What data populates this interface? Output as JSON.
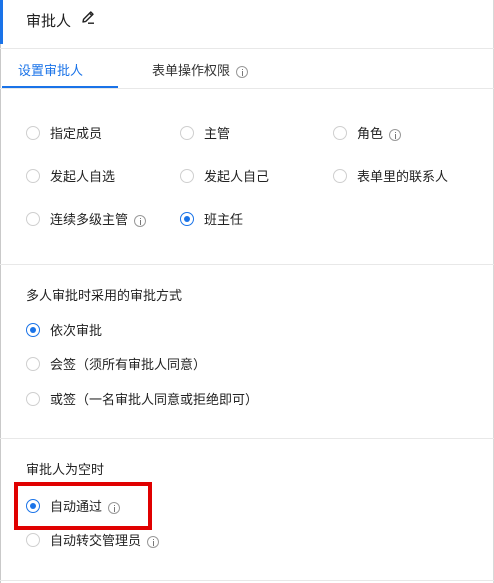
{
  "header": {
    "title": "审批人",
    "edit_icon": "pencil-icon"
  },
  "tabs": [
    {
      "label": "设置审批人",
      "active": true
    },
    {
      "label": "表单操作权限",
      "active": false,
      "icon": "info-icon"
    }
  ],
  "approver_types": [
    {
      "label": "指定成员",
      "checked": false,
      "info": false
    },
    {
      "label": "主管",
      "checked": false,
      "info": false
    },
    {
      "label": "角色",
      "checked": false,
      "info": true
    },
    {
      "label": "发起人自选",
      "checked": false,
      "info": false
    },
    {
      "label": "发起人自己",
      "checked": false,
      "info": false
    },
    {
      "label": "表单里的联系人",
      "checked": false,
      "info": false
    },
    {
      "label": "连续多级主管",
      "checked": false,
      "info": true
    },
    {
      "label": "班主任",
      "checked": true,
      "info": false
    }
  ],
  "multi_approval": {
    "title": "多人审批时采用的审批方式",
    "options": [
      {
        "label": "依次审批",
        "checked": true
      },
      {
        "label": "会签（须所有审批人同意）",
        "checked": false
      },
      {
        "label": "或签（一名审批人同意或拒绝即可）",
        "checked": false
      }
    ]
  },
  "empty_approver": {
    "title": "审批人为空时",
    "options": [
      {
        "label": "自动通过",
        "checked": true,
        "info": true
      },
      {
        "label": "自动转交管理员",
        "checked": false,
        "info": true
      }
    ]
  },
  "colors": {
    "accent": "#1a73e8",
    "highlight": "#e00000"
  }
}
